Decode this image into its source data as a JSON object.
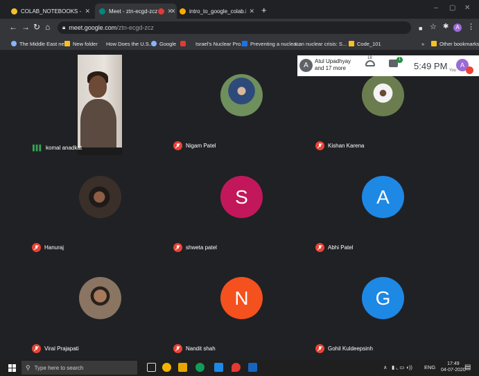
{
  "browser": {
    "tabs": [
      {
        "label": "COLAB_NOTEBOOKS - Google D",
        "favicon_color": "#f6c026"
      },
      {
        "label": "Meet - ztn-ecgd-zcz",
        "favicon_color": "#00897b"
      },
      {
        "label": "",
        "favicon_color": "#e53935"
      },
      {
        "label": "intro_to_google_colab.ipynb - Co",
        "favicon_color": "#f9ab00"
      }
    ],
    "new_tab": "+",
    "window_controls": [
      "–",
      "▢",
      "✕"
    ],
    "url_host": "meet.google.com",
    "url_path": "/ztn-ecgd-zcz",
    "bookmarks": [
      {
        "label": "The Middle East ne...",
        "icon": "globe"
      },
      {
        "label": "New folder",
        "icon": "folder"
      },
      {
        "label": "How Does the U.S....",
        "icon": "none"
      },
      {
        "label": "Google",
        "icon": "globe"
      },
      {
        "label": "Israel's Nuclear Pro...",
        "icon": "red"
      },
      {
        "label": "Preventing a nuclea...",
        "icon": "blueH"
      },
      {
        "label": "Iran nuclear crisis: S...",
        "icon": "none"
      },
      {
        "label": "Code_101",
        "icon": "folder"
      }
    ],
    "bookmarks_more": "»",
    "other_bookmarks": "Other bookmarks"
  },
  "meet": {
    "participant_summary_name": "Atul Upadhyay",
    "participant_summary_more": "and 17 more",
    "people_count": "18",
    "chat_badge": "1",
    "time": "5:49 PM",
    "you_label": "You",
    "self_initial": "A",
    "people_avatar_initial": "A",
    "participants": [
      {
        "name": "komal anadkat",
        "avatar": "video",
        "mic": "talking"
      },
      {
        "name": "Nigam Patel",
        "avatar": "photo",
        "mic": "muted",
        "photo_color": "#2e4a7a"
      },
      {
        "name": "Kishan Karena",
        "avatar": "photo",
        "mic": "muted",
        "photo_color": "#6b7d4e"
      },
      {
        "name": "Hanuraj",
        "avatar": "photo",
        "mic": "muted",
        "photo_color": "#3b2f2a"
      },
      {
        "name": "shweta patel",
        "avatar": "letter",
        "letter": "S",
        "mic": "muted",
        "color": "#c2185b"
      },
      {
        "name": "Abhi Patel",
        "avatar": "letter",
        "letter": "A",
        "mic": "muted",
        "color": "#1e88e5"
      },
      {
        "name": "Viral Prajapati",
        "avatar": "photo",
        "mic": "muted",
        "photo_color": "#8a7562"
      },
      {
        "name": "Nandit shah",
        "avatar": "letter",
        "letter": "N",
        "mic": "muted",
        "color": "#f4511e"
      },
      {
        "name": "Gohil Kuldeepsinh",
        "avatar": "letter",
        "letter": "G",
        "mic": "muted",
        "color": "#1e88e5"
      }
    ]
  },
  "taskbar": {
    "search_placeholder": "Type here to search",
    "tray_lang": "ENG",
    "clock_time": "17:49",
    "clock_date": "04-07-2020"
  }
}
